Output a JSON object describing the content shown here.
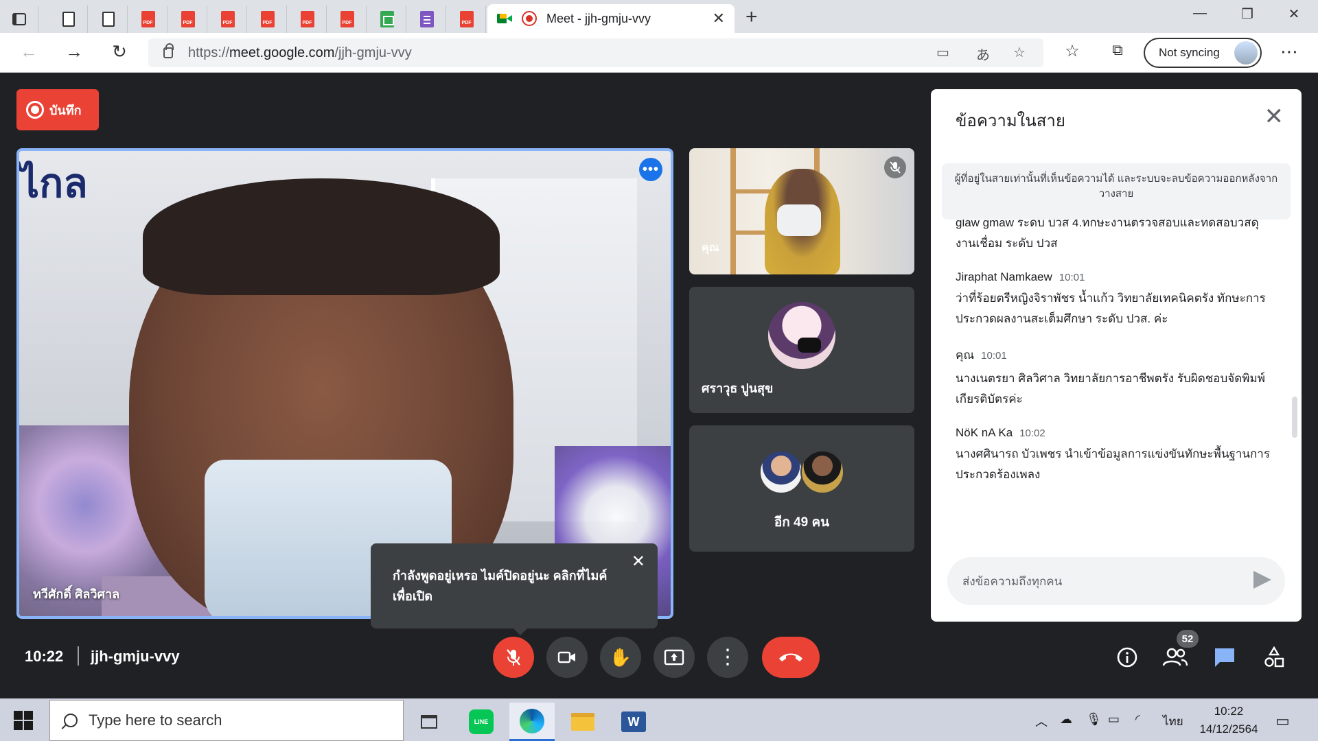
{
  "browser": {
    "active_tab_title": "Meet - jjh-gmju-vvy",
    "url_prefix": "https://",
    "url_host": "meet.google.com",
    "url_path": "/jjh-gmju-vvy",
    "profile_label": "Not syncing",
    "tab_icons": [
      "tab-actions-icon",
      "doc-icon",
      "doc-icon",
      "pdf-icon",
      "pdf-icon",
      "pdf-icon",
      "pdf-icon",
      "pdf-icon",
      "pdf-icon",
      "sheets-icon",
      "forms-icon",
      "pdf-icon"
    ]
  },
  "meet": {
    "record_label": "บันทึก",
    "main_speaker_name": "ทวีศักดิ์ ศิลวิศาล",
    "tiles": {
      "you_label": "คุณ",
      "participant_name": "ศราวุธ ปูนสุข",
      "more_label": "อีก 49 คน"
    },
    "tooltip": {
      "text": "กำลังพูดอยู่เหรอ ไมค์ปิดอยู่นะ คลิกที่ไมค์เพื่อเปิด"
    },
    "time": "10:22",
    "meeting_code": "jjh-gmju-vvy",
    "participant_count": "52",
    "accent_red": "#ea4335",
    "accent_blue": "#8ab4f8"
  },
  "chat": {
    "title": "ข้อความในสาย",
    "notice": "ผู้ที่อยู่ในสายเท่านั้นที่เห็นข้อความได้ และระบบจะลบข้อความออกหลังจากวางสาย",
    "partial_text": "glaw gmaw ระดับ ปวส 4.ทักษะงานตรวจสอบและทดสอบวัสดุงานเชื่อม ระดับ ปวส",
    "messages": [
      {
        "sender": "Jiraphat Namkaew",
        "time": "10:01",
        "text": "ว่าที่ร้อยตรีหญิงจิราพัชร น้ำแก้ว วิทยาลัยเทคนิคตรัง ทักษะการประกวดผลงานสะเต็มศึกษา ระดับ ปวส. ค่ะ"
      },
      {
        "sender": "คุณ",
        "time": "10:01",
        "text": "นางเนตรยา ศิลวิศาล วิทยาลัยการอาชีพตรัง รับผิดชอบจัดพิมพ์เกียรติบัตรค่ะ"
      },
      {
        "sender": "NöK nA Ka",
        "time": "10:02",
        "text": "นางศศินารถ บัวเพชร นำเข้าข้อมูลการแข่งขันทักษะพื้นฐานการประกวดร้องเพลง"
      }
    ],
    "input_placeholder": "ส่งข้อความถึงทุกคน"
  },
  "taskbar": {
    "search_placeholder": "Type here to search",
    "language": "ไทย",
    "time": "10:22",
    "date": "14/12/2564"
  }
}
